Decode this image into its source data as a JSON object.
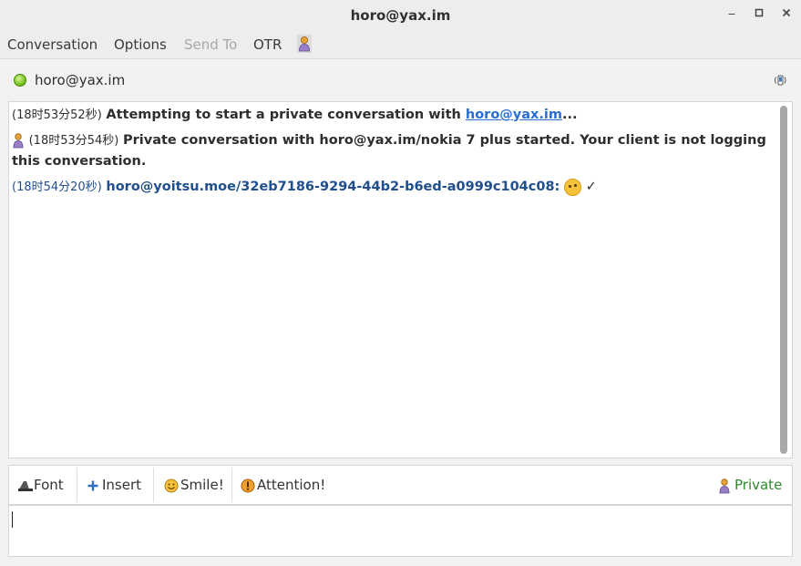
{
  "window": {
    "title": "horo@yax.im"
  },
  "menubar": {
    "items": [
      {
        "label": "Conversation",
        "enabled": true
      },
      {
        "label": "Options",
        "enabled": true
      },
      {
        "label": "Send To",
        "enabled": false
      },
      {
        "label": "OTR",
        "enabled": true
      }
    ],
    "otr_status_icon": "person-icon"
  },
  "buddy": {
    "name": "horo@yax.im",
    "status_icon": "available-icon",
    "status_color": "#73d216",
    "right_icon": "phone-icon"
  },
  "messages": [
    {
      "timestamp": "(18时53分52秒)",
      "text_before": "Attempting to start a private conversation with ",
      "link": "horo@yax.im",
      "text_after": "..."
    },
    {
      "icon": "person-icon",
      "timestamp": "(18时53分54秒)",
      "text_line1": "Private conversation with horo@yax.im/nokia 7 plus started.  Your client is not logging",
      "text_line2": "this conversation."
    },
    {
      "timestamp": "(18时54分20秒)",
      "sender": "horo@yoitsu.moe/32eb7186-9294-44b2-b6ed-a0999c104c08:",
      "emoji": "thinking-face-icon",
      "body": "✓"
    }
  ],
  "toolbar": {
    "font_label": "Font",
    "insert_label": "Insert",
    "smile_label": "Smile!",
    "attention_label": "Attention!",
    "private_label": "Private"
  },
  "colors": {
    "link": "#2a6fd0",
    "sender": "#1f4f8e",
    "private": "#2d8a2d"
  },
  "input": {
    "value": ""
  }
}
